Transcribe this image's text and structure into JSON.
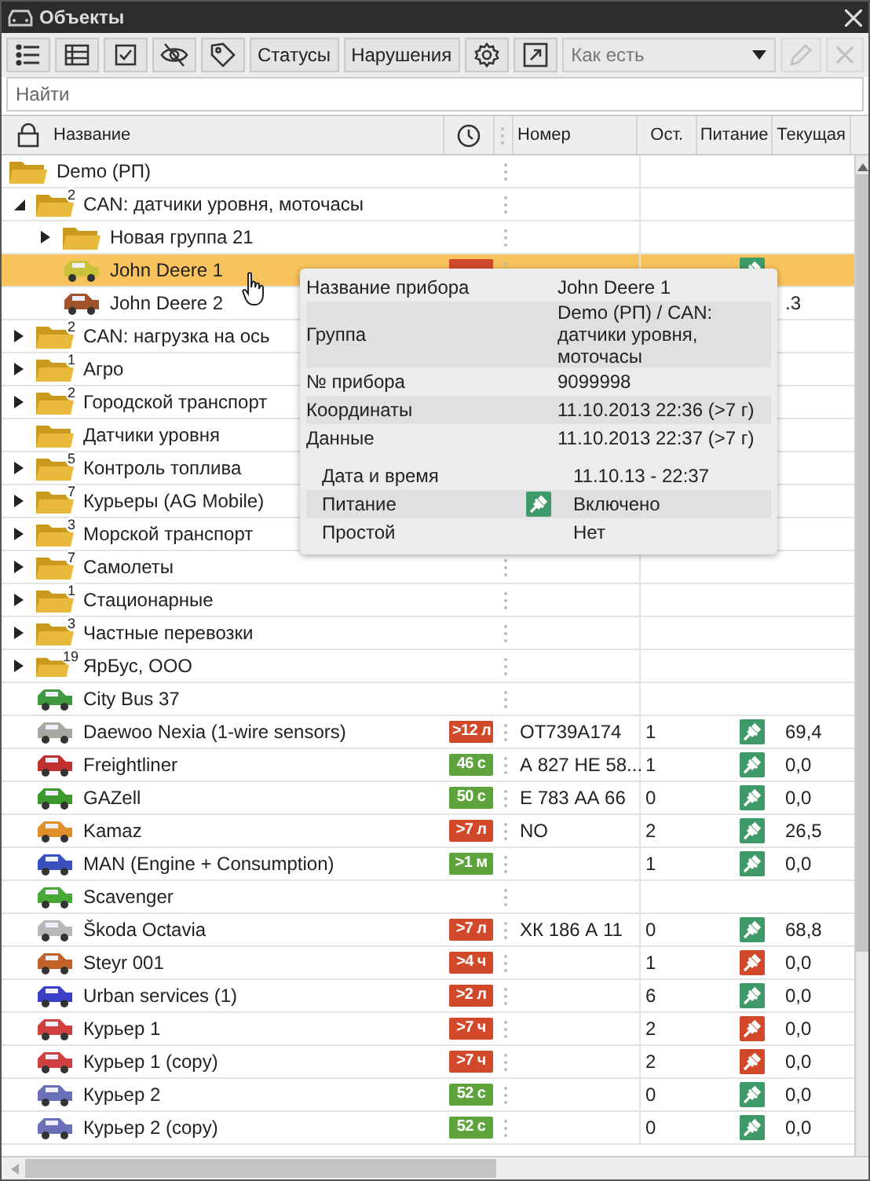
{
  "window": {
    "title": "Объекты"
  },
  "toolbar": {
    "buttons": [
      {
        "kind": "list"
      },
      {
        "kind": "table"
      },
      {
        "kind": "check"
      },
      {
        "kind": "hide"
      },
      {
        "kind": "tag"
      }
    ],
    "text_buttons": [
      "Статусы",
      "Нарушения"
    ],
    "icon_buttons": [
      {
        "kind": "settings"
      },
      {
        "kind": "export"
      }
    ],
    "sort_select": {
      "value": "Как есть"
    },
    "edit_disabled": true,
    "delete_disabled": true
  },
  "search": {
    "placeholder": "Найти"
  },
  "table": {
    "columns": [
      {
        "kind": "name",
        "label": "Название"
      },
      {
        "kind": "time"
      },
      {
        "kind": "handle"
      },
      {
        "kind": "text",
        "label": "Номер"
      },
      {
        "kind": "text",
        "label": "Ост."
      },
      {
        "kind": "text",
        "label": "Питание"
      },
      {
        "kind": "text",
        "label": "Текущая"
      }
    ],
    "rows": [
      {
        "kind": "group",
        "name": "Demo (РП)",
        "selected": false,
        "children": [
          {
            "kind": "group",
            "name": "CAN: датчики уровня, моточасы",
            "count": "2",
            "expanded": true,
            "selected": false,
            "children": [
              {
                "kind": "group",
                "name": "Новая группа 21",
                "expanded": false,
                "selected": false
              },
              {
                "kind": "object",
                "name": "John Deere 1",
                "color": "#c8c23a",
                "selected": true,
                "badge": {
                  "color": "#d2482b"
                },
                "powered": true
              },
              {
                "kind": "object",
                "name": "John Deere 2",
                "color": "#a0522d",
                "selected": false,
                "current": ".3"
              }
            ]
          },
          {
            "kind": "group",
            "name": "CAN: нагрузка на ось",
            "count": "2",
            "expanded": false,
            "selected": false
          },
          {
            "kind": "group",
            "name": "Агро",
            "count": "1",
            "expanded": false,
            "selected": false
          },
          {
            "kind": "group",
            "name": "Городской транспорт",
            "count": "2",
            "expanded": false,
            "selected": false
          },
          {
            "kind": "group",
            "name": "Датчики уровня",
            "selected": false
          },
          {
            "kind": "group",
            "name": "Контроль топлива",
            "count": "5",
            "expanded": false,
            "selected": false
          },
          {
            "kind": "group",
            "name": "Курьеры (AG Mobile)",
            "count": "7",
            "expanded": false,
            "selected": false
          },
          {
            "kind": "group",
            "name": "Морской транспорт",
            "count": "3",
            "expanded": false,
            "selected": false
          },
          {
            "kind": "group",
            "name": "Самолеты",
            "count": "7",
            "expanded": false,
            "selected": false
          },
          {
            "kind": "group",
            "name": "Стационарные",
            "count": "1",
            "expanded": false,
            "selected": false
          },
          {
            "kind": "group",
            "name": "Частные перевозки",
            "count": "3",
            "expanded": false,
            "selected": false
          },
          {
            "kind": "group",
            "name": "ЯрБус, ООО",
            "count": "19",
            "expanded": false,
            "selected": false
          },
          {
            "kind": "object",
            "name": "City Bus 37",
            "color": "#3f9a3f",
            "selected": false
          },
          {
            "kind": "object",
            "name": "Daewoo Nexia (1-wire sensors)",
            "color": "#a8a8a0",
            "selected": false,
            "badge": {
              "color": "#d2482b",
              "text": ">12 л"
            },
            "number": "ОТ739А174",
            "ost": "1",
            "powered": true,
            "current": "69,4"
          },
          {
            "kind": "object",
            "name": "Freightliner",
            "color": "#c03030",
            "selected": false,
            "badge": {
              "color": "#5fa33f",
              "text": "46 с"
            },
            "number": "А 827 НЕ 58...",
            "ost": "1",
            "powered": true,
            "current": "0,0"
          },
          {
            "kind": "object",
            "name": "GAZell",
            "color": "#3c9a2c",
            "selected": false,
            "badge": {
              "color": "#5fa33f",
              "text": "50 с"
            },
            "number": "Е 783 АА 66",
            "ost": "0",
            "powered": true,
            "current": "0,0"
          },
          {
            "kind": "object",
            "name": "Kamaz",
            "color": "#e0902a",
            "selected": false,
            "badge": {
              "color": "#d2482b",
              "text": ">7 л"
            },
            "number": "NO",
            "ost": "2",
            "powered": true,
            "current": "26,5"
          },
          {
            "kind": "object",
            "name": "MAN (Engine + Consumption)",
            "color": "#3a4fc0",
            "selected": false,
            "badge": {
              "color": "#5fa33f",
              "text": ">1 м"
            },
            "ost": "1",
            "powered": true,
            "current": "0,0"
          },
          {
            "kind": "object",
            "name": "Scavenger",
            "color": "#48a838",
            "selected": false
          },
          {
            "kind": "object",
            "name": "Škoda Octavia",
            "color": "#b8b8b8",
            "selected": false,
            "badge": {
              "color": "#d2482b",
              "text": ">7 л"
            },
            "number": "ХК 186 А 11",
            "ost": "0",
            "powered": true,
            "current": "68,8"
          },
          {
            "kind": "object",
            "name": "Steyr 001",
            "color": "#c0622a",
            "selected": false,
            "badge": {
              "color": "#d2482b",
              "text": ">4 ч"
            },
            "ost": "1",
            "powered": false,
            "current": "0,0"
          },
          {
            "kind": "object",
            "name": "Urban services (1)",
            "color": "#3a40c8",
            "selected": false,
            "badge": {
              "color": "#d2482b",
              "text": ">2 л"
            },
            "ost": "6",
            "powered": true,
            "current": "0,0"
          },
          {
            "kind": "object",
            "name": "Курьер 1",
            "color": "#d04040",
            "selected": false,
            "badge": {
              "color": "#d2482b",
              "text": ">7 ч"
            },
            "ost": "2",
            "powered": false,
            "current": "0,0"
          },
          {
            "kind": "object",
            "name": "Курьер 1 (copy)",
            "color": "#d04040",
            "selected": false,
            "badge": {
              "color": "#d2482b",
              "text": ">7 ч"
            },
            "ost": "2",
            "powered": false,
            "current": "0,0"
          },
          {
            "kind": "object",
            "name": "Курьер 2",
            "color": "#6a70b8",
            "selected": false,
            "badge": {
              "color": "#5fa33f",
              "text": "52 с"
            },
            "ost": "0",
            "powered": true,
            "current": "0,0"
          },
          {
            "kind": "object",
            "name": "Курьер 2 (copy)",
            "color": "#6a70b8",
            "selected": false,
            "badge": {
              "color": "#5fa33f",
              "text": "52 с"
            },
            "ost": "0",
            "powered": true,
            "current": "0,0"
          }
        ]
      }
    ]
  },
  "tooltip": {
    "fields": [
      {
        "label": "Название прибора",
        "value": "John Deere 1"
      },
      {
        "label": "Группа",
        "value": "Demo (РП) / CAN: датчики уровня, моточасы"
      },
      {
        "label": "№ прибора",
        "value": "9099998"
      },
      {
        "label": "Координаты",
        "value": "11.10.2013 22:36 (>7 г)"
      },
      {
        "label": "Данные",
        "value": "11.10.2013 22:37 (>7 г)"
      }
    ],
    "sensors": [
      {
        "label": "Дата и время",
        "value": "11.10.13 - 22:37"
      },
      {
        "label": "Питание",
        "value": "Включено",
        "powered": true
      },
      {
        "label": "Простой",
        "value": "Нет"
      }
    ]
  }
}
